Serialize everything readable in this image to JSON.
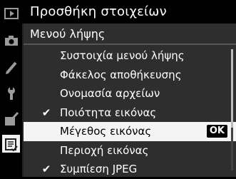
{
  "header": {
    "title": "Προσθήκη στοιχείων"
  },
  "sidebar": {
    "icons": [
      {
        "name": "playback-icon"
      },
      {
        "name": "camera-icon"
      },
      {
        "name": "pencil-icon"
      },
      {
        "name": "wrench-icon"
      },
      {
        "name": "retouch-icon"
      },
      {
        "name": "my-menu-icon"
      }
    ]
  },
  "submenu": {
    "title": "Μενού λήψης",
    "items": [
      {
        "label": "Συστοιχία μενού λήψης",
        "checked": false
      },
      {
        "label": "Φάκελος αποθήκευσης",
        "checked": false
      },
      {
        "label": "Ονομασία αρχείων",
        "checked": false
      },
      {
        "label": "Ποιότητα εικόνας",
        "checked": true,
        "check_mark": "✔"
      },
      {
        "label": "Μέγεθος εικόνας",
        "checked": false,
        "selected": true,
        "ok_label": "OK"
      },
      {
        "label": "Περιοχή εικόνας",
        "checked": false
      },
      {
        "label": "Συμπίεση JPEG",
        "checked": true,
        "check_mark": "✔"
      }
    ]
  },
  "colors": {
    "panel_bg": "#2e2e2e",
    "selected_bg": "#f4f4f4",
    "background": "#000000"
  }
}
